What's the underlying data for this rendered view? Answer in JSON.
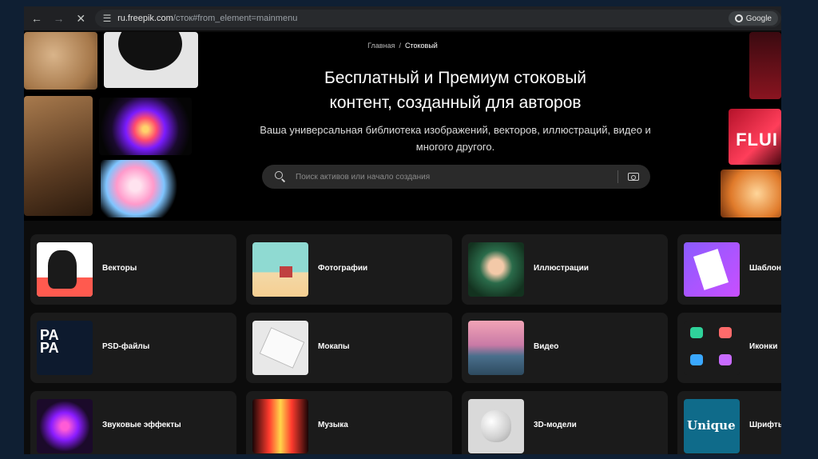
{
  "browser": {
    "url_host": "ru.freepik.com",
    "url_path": "/сток#from_element=mainmenu",
    "google_label": "Google"
  },
  "hero": {
    "breadcrumb": [
      "Главная",
      "Стоковый"
    ],
    "breadcrumb_sep": "/",
    "title_line1": "Бесплатный и Премиум стоковый",
    "title_line2": "контент, созданный для авторов",
    "subtitle_line1": "Ваша универсальная библиотека изображений, векторов, иллюстраций, видео и",
    "subtitle_line2": "многого другого.",
    "search_placeholder": "Поиск активов или начало создания",
    "collage_text": "FLUI"
  },
  "categories": [
    {
      "label": "Векторы",
      "thumb": "leopard-vector-illustration"
    },
    {
      "label": "Фотографии",
      "thumb": "beach-lifeguard-tower-photo"
    },
    {
      "label": "Иллюстрации",
      "thumb": "woman-portrait-illustration"
    },
    {
      "label": "Шаблоны",
      "thumb": "social-template-cards"
    },
    {
      "label": "PSD-файлы",
      "thumb": "party-flyer-psd"
    },
    {
      "label": "Мокапы",
      "thumb": "book-mockup"
    },
    {
      "label": "Видео",
      "thumb": "seaside-sunset-video"
    },
    {
      "label": "Иконки",
      "thumb": "cloud-icons-set"
    },
    {
      "label": "Звуковые эффекты",
      "thumb": "neon-sphere"
    },
    {
      "label": "Музыка",
      "thumb": "sound-wave"
    },
    {
      "label": "3D-модели",
      "thumb": "3d-white-shape"
    },
    {
      "label": "Шрифты",
      "thumb": "unique-lettering"
    }
  ],
  "thumb_text": {
    "psd": "PA\nPA",
    "fonts": "Unique"
  },
  "colors": {
    "page_bg": "#0f1f33",
    "card_bg": "#1b1b1b",
    "search_bg": "#2a2a2a"
  }
}
